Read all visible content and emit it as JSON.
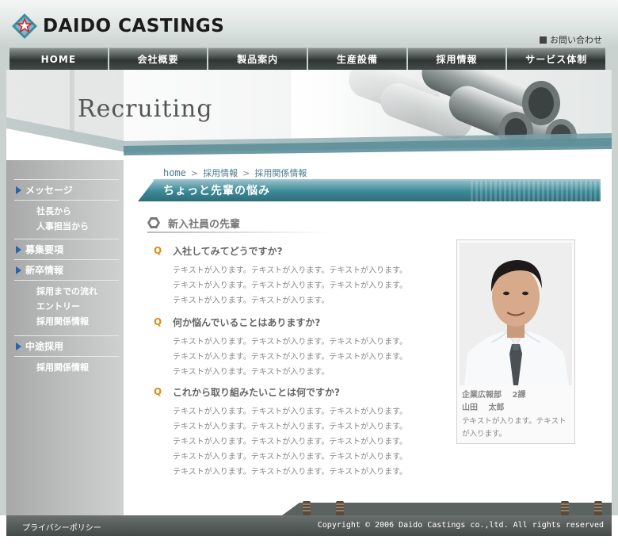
{
  "header": {
    "logo_text": "DAIDO CASTINGS",
    "contact_label": "お問い合わせ"
  },
  "nav": {
    "items": [
      {
        "label": "HOME"
      },
      {
        "label": "会社概要"
      },
      {
        "label": "製品案内"
      },
      {
        "label": "生産設備"
      },
      {
        "label": "採用情報"
      },
      {
        "label": "サービス体制"
      }
    ]
  },
  "hero": {
    "title": "Recruiting"
  },
  "sidebar": {
    "groups": [
      {
        "label": "メッセージ",
        "subs": [
          "社長から",
          "人事担当から"
        ]
      },
      {
        "label": "募集要項",
        "subs": []
      },
      {
        "label": "新卒情報",
        "subs": [
          "採用までの流れ",
          "エントリー",
          "採用関係情報"
        ]
      },
      {
        "label": "中途採用",
        "subs": [
          "採用関係情報"
        ]
      }
    ]
  },
  "breadcrumb": {
    "home": "home",
    "sep": ">",
    "items": [
      "採用情報",
      "採用関係情報"
    ]
  },
  "page": {
    "banner_title": "ちょっと先輩の悩み",
    "section_title": "新入社員の先輩"
  },
  "qa": [
    {
      "mark": "Q",
      "question": "入社してみてどうですか?",
      "answer": [
        "テキストが入ります。テキストが入ります。テキストが入ります。",
        "テキストが入ります。テキストが入ります。テキストが入ります。",
        "テキストが入ります。テキストが入ります。"
      ]
    },
    {
      "mark": "Q",
      "question": "何か悩んでいることはありますか?",
      "answer": [
        "テキストが入ります。テキストが入ります。テキストが入ります。",
        "テキストが入ります。テキストが入ります。テキストが入ります。",
        "テキストが入ります。テキストが入ります。"
      ]
    },
    {
      "mark": "Q",
      "question": "これから取り組みたいことは何ですか?",
      "answer": [
        "テキストが入ります。テキストが入ります。テキストが入ります。",
        "テキストが入ります。テキストが入ります。テキストが入ります。",
        "テキストが入ります。テキストが入ります。テキストが入ります。",
        "テキストが入ります。テキストが入ります。テキストが入ります。",
        "テキストが入ります。テキストが入ります。テキストが入ります。"
      ]
    }
  ],
  "profile": {
    "dept": "企業広報部　 2課",
    "name": "山田　 太郎",
    "note": "テキストが入ります。テキストが入ります。"
  },
  "footer": {
    "privacy": "プライバシーポリシー",
    "copyright": "Copyright ©  2006 Daido Castings co.,ltd.  All rights reserved"
  },
  "colors": {
    "accent_teal": "#3d8a98",
    "question_orange": "#e38a1a",
    "side_triangle": "#2a62b0",
    "logo_red": "#d3242c"
  },
  "icons": {
    "logo_mark": "star-emblem-icon",
    "contact": "square-bullet-icon",
    "sidebar_bullet": "triangle-right-icon",
    "section_bullet": "hexagon-icon"
  }
}
